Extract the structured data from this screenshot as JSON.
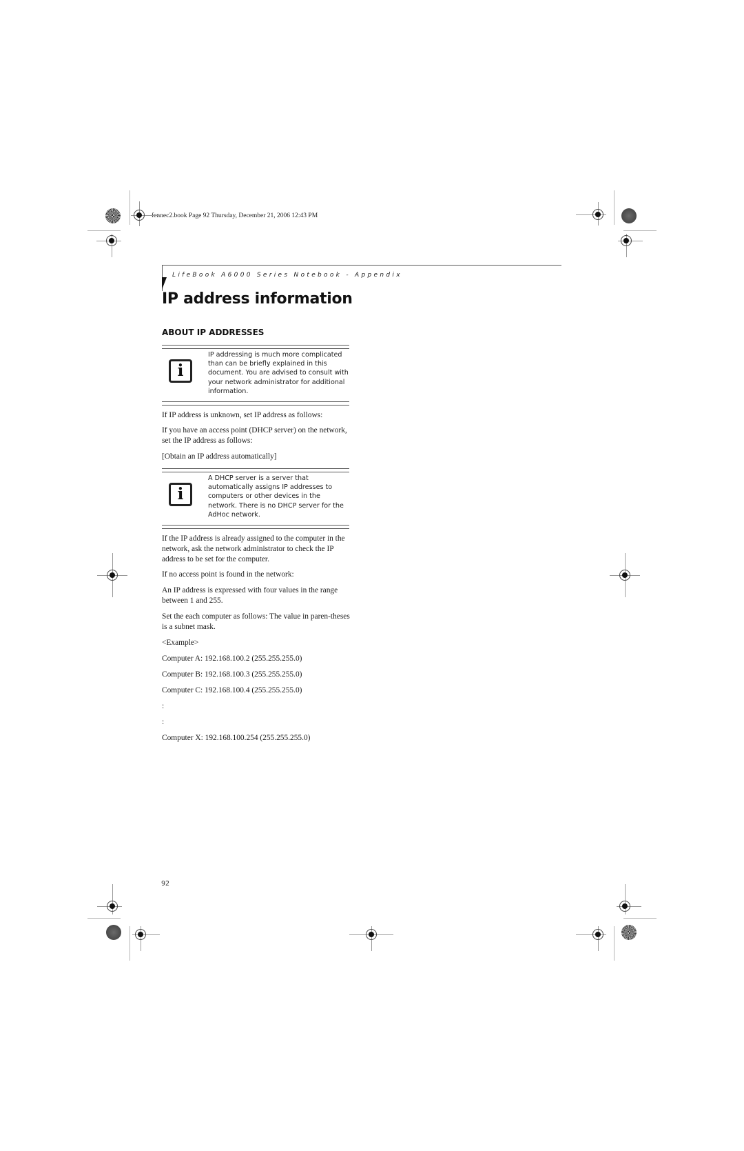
{
  "slug": "fennec2.book  Page 92  Thursday, December 21, 2006  12:43 PM",
  "running_head": "LifeBook A6000 Series Notebook - Appendix",
  "page_title": "IP address information",
  "section_heading": "ABOUT IP ADDRESSES",
  "notes": [
    {
      "icon": "info-icon",
      "icon_glyph": "i",
      "text": "IP addressing is much more complicated than can be briefly explained in this document. You are advised to consult with your network administrator for additional information."
    },
    {
      "icon": "info-icon",
      "icon_glyph": "i",
      "text": "A DHCP server is a server that automatically assigns IP addresses to computers or other devices in the network. There is no DHCP server for the AdHoc network."
    }
  ],
  "paragraphs": [
    "If IP address is unknown, set IP address as follows:",
    "If you have an access point (DHCP server) on the network, set the IP address as follows:",
    "[Obtain an IP address automatically]",
    "If the IP address is already assigned to the computer in the network, ask the network administrator to check the IP address to be set for the computer.",
    "If no access point is found in the network:",
    "An IP address is expressed with four values in the range between 1 and 255.",
    "Set the each computer as follows: The value in paren-theses is a subnet mask.",
    "<Example>",
    "Computer A: 192.168.100.2 (255.255.255.0)",
    "Computer B: 192.168.100.3 (255.255.255.0)",
    "Computer C: 192.168.100.4 (255.255.255.0)",
    ":",
    ":",
    "Computer X: 192.168.100.254 (255.255.255.0)"
  ],
  "page_number": "92"
}
